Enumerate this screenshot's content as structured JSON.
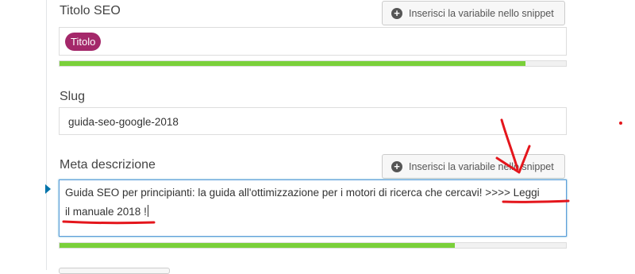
{
  "title_field": {
    "label": "Titolo SEO",
    "insert_button": "Inserisci la variabile nello snippet",
    "tag": "Titolo",
    "progress": 0.92
  },
  "slug_field": {
    "label": "Slug",
    "value": "guida-seo-google-2018"
  },
  "meta_field": {
    "label": "Meta descrizione",
    "insert_button": "Inserisci la variabile nello snippet",
    "value_line1": "Guida SEO per principianti: la guida all'ottimizzazione per i motori di ricerca che cercavi! >>>> Leggi",
    "value_line2": "il manuale 2018 !",
    "progress": 0.78
  },
  "colors": {
    "accent_tag": "#a4286a",
    "progress_good": "#7ad03a",
    "annotation_red": "#e4161c",
    "focus_blue": "#5b9dd9"
  }
}
